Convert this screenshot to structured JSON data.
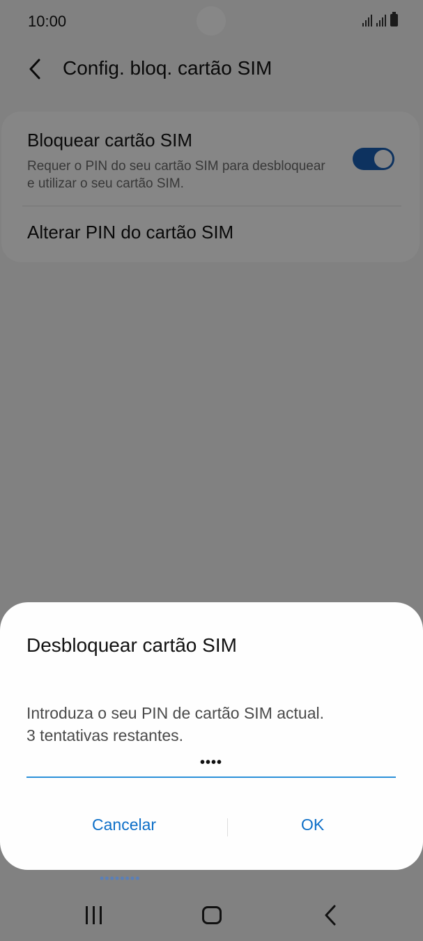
{
  "status_bar": {
    "time": "10:00"
  },
  "header": {
    "title": "Config. bloq. cartão SIM",
    "back_icon": "chevron-left-icon"
  },
  "settings": {
    "lock_sim": {
      "title": "Bloquear cartão SIM",
      "subtitle": "Requer o PIN do seu cartão SIM para desbloquear e utilizar o seu cartão SIM.",
      "enabled": true
    },
    "change_pin": {
      "title": "Alterar PIN do cartão SIM"
    }
  },
  "dialog": {
    "title": "Desbloquear cartão SIM",
    "message_line1": "Introduza o seu PIN de cartão SIM actual.",
    "message_line2": "3 tentativas restantes.",
    "pin_value": "••••",
    "cancel_label": "Cancelar",
    "ok_label": "OK"
  },
  "behind_dots": "••••••••",
  "colors": {
    "accent": "#1a5fb4",
    "button_text": "#0d6fc8",
    "input_underline": "#2b90d9"
  },
  "nav_bar": {
    "recents_icon": "recents-icon",
    "home_icon": "home-icon",
    "back_icon": "back-icon"
  }
}
